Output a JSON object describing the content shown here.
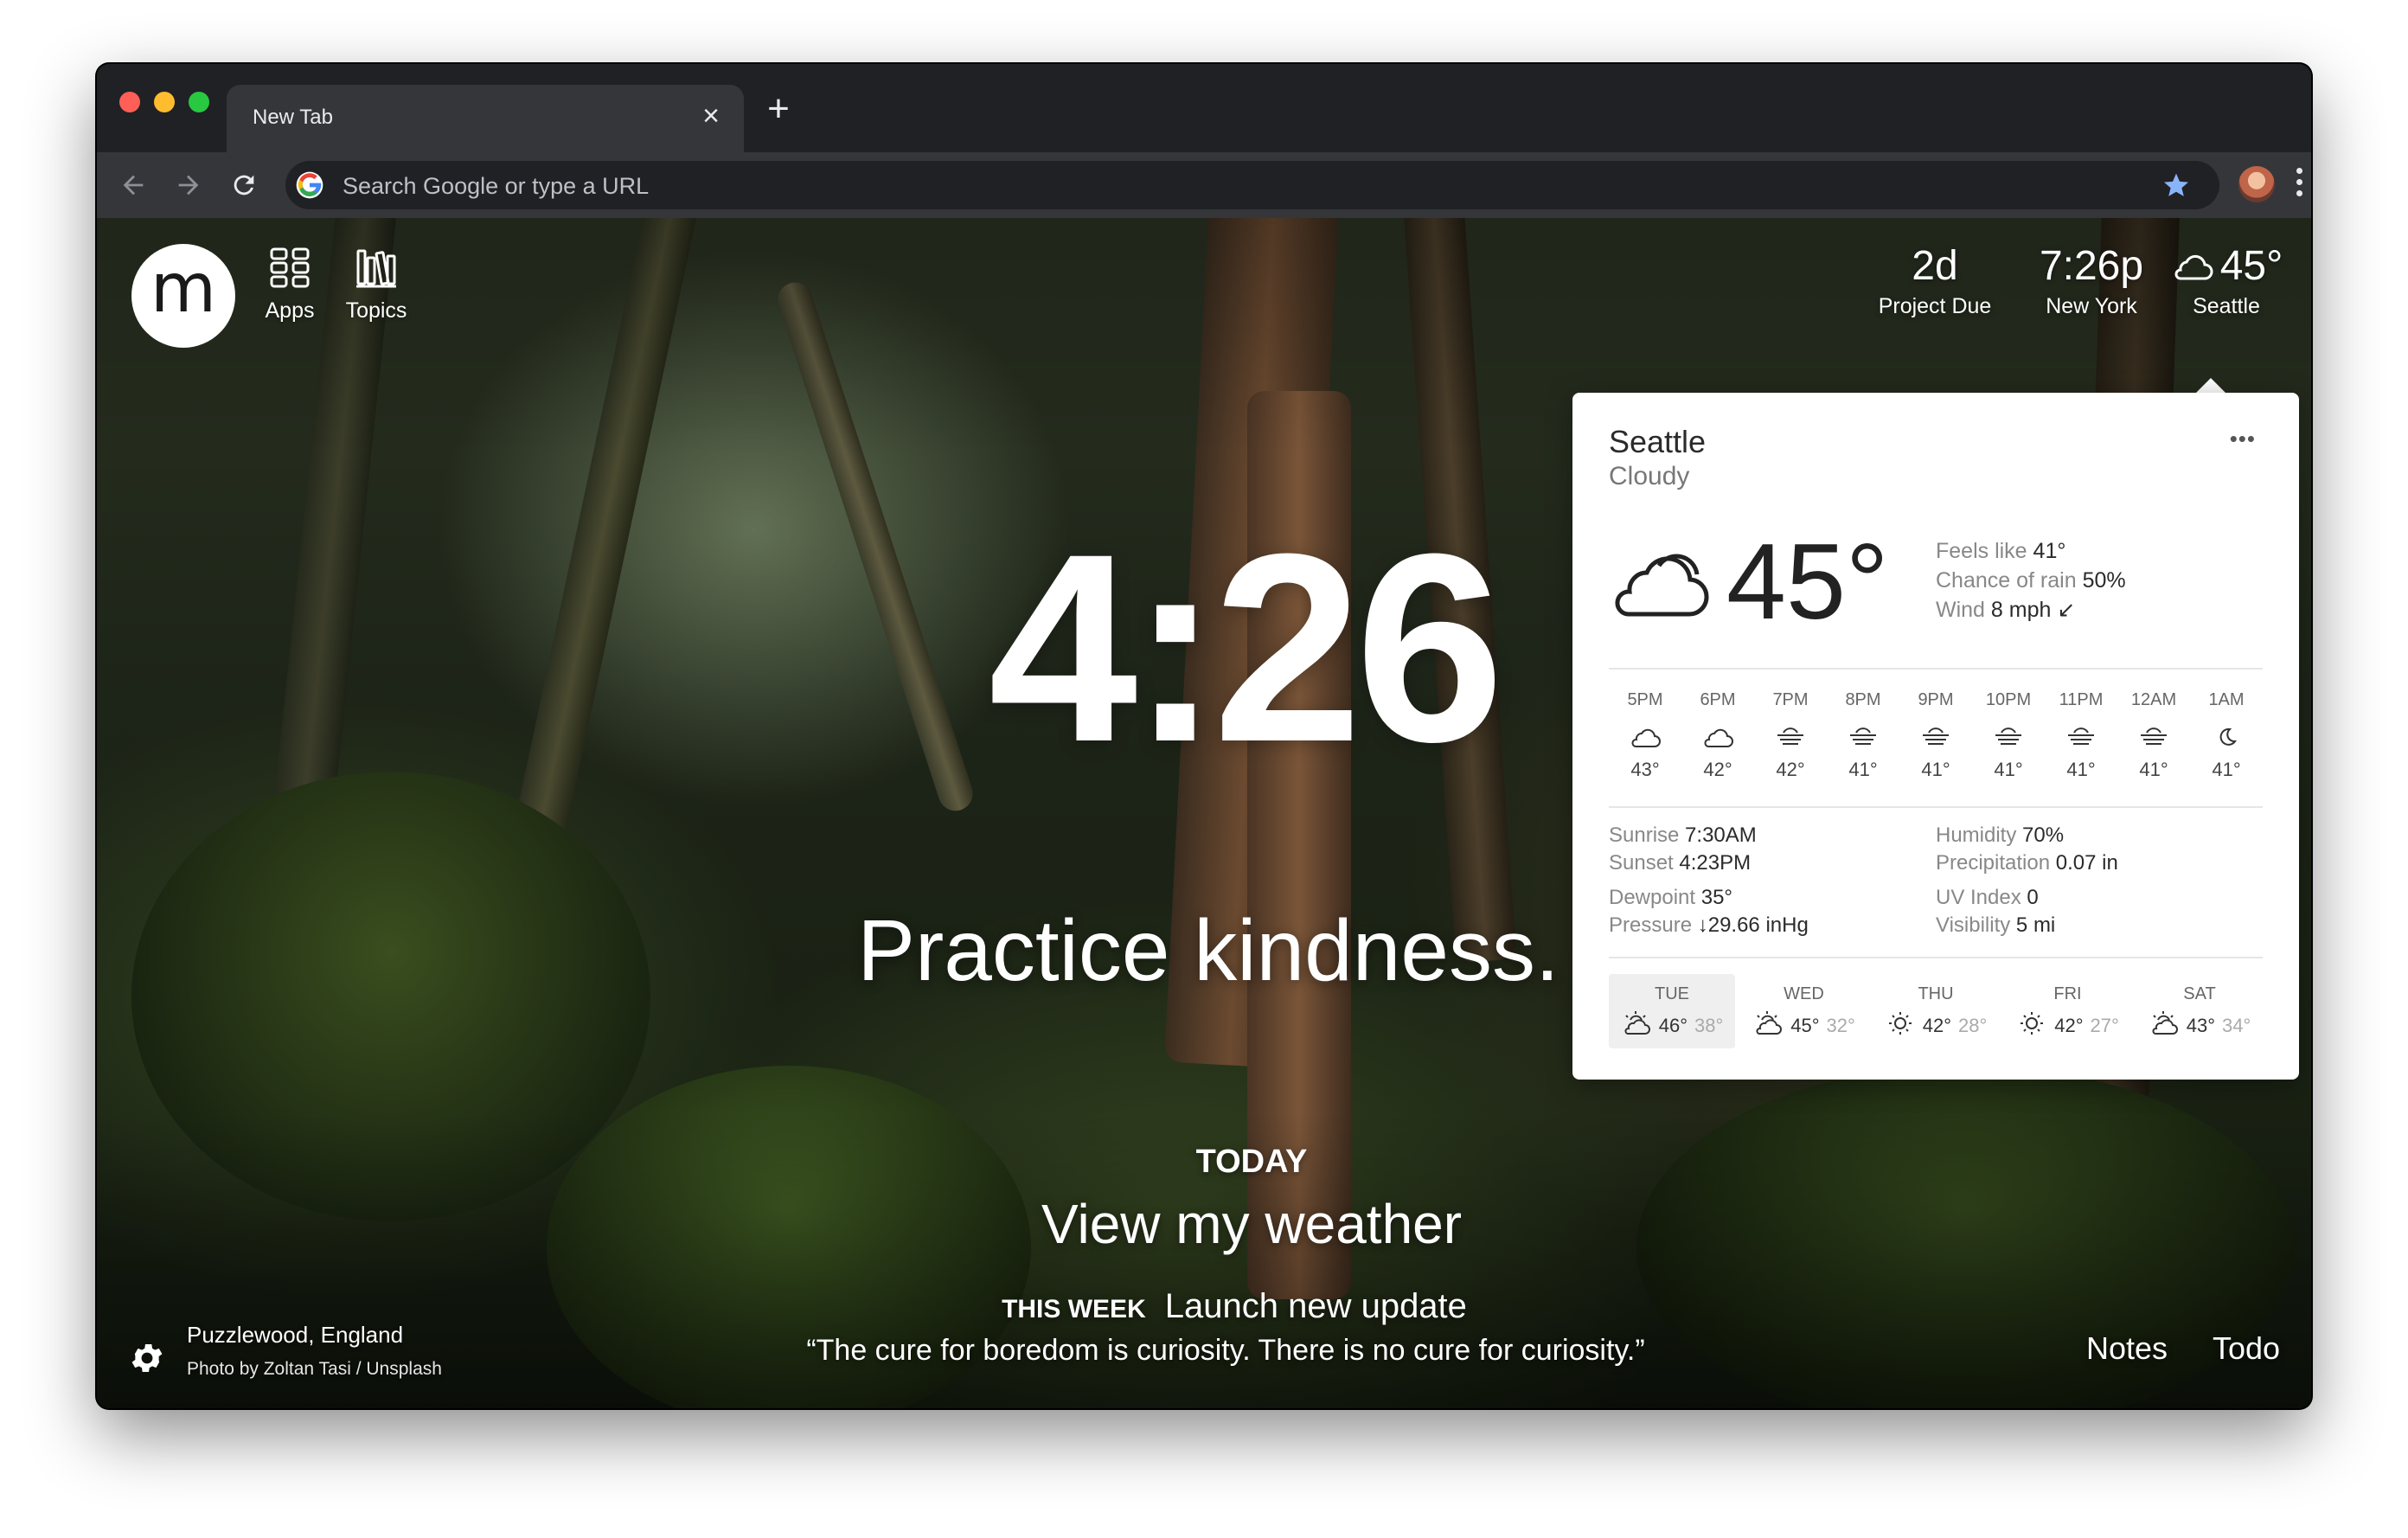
{
  "browser": {
    "tab_title": "New Tab",
    "tab_close": "×",
    "new_tab": "+",
    "omnibox_placeholder": "Search Google or type a URL"
  },
  "launcher": {
    "logo_letter": "m",
    "apps_label": "Apps",
    "topics_label": "Topics"
  },
  "widgets": {
    "countdown_value": "2d",
    "countdown_label": "Project Due",
    "time_value": "7:26p",
    "time_label": "New York",
    "weather_value": "45°",
    "weather_label": "Seattle"
  },
  "weather_panel": {
    "city": "Seattle",
    "condition": "Cloudy",
    "more": "•••",
    "temperature": "45°",
    "feels_like_label": "Feels like",
    "feels_like": "41°",
    "rain_label": "Chance of rain",
    "rain": "50%",
    "wind_label": "Wind",
    "wind": "8 mph ↙",
    "hourly": [
      {
        "time": "5PM",
        "icon": "cloud-icon",
        "temp": "43°"
      },
      {
        "time": "6PM",
        "icon": "cloud-icon",
        "temp": "42°"
      },
      {
        "time": "7PM",
        "icon": "fog-moon-icon",
        "temp": "42°"
      },
      {
        "time": "8PM",
        "icon": "fog-moon-icon",
        "temp": "41°"
      },
      {
        "time": "9PM",
        "icon": "fog-moon-icon",
        "temp": "41°"
      },
      {
        "time": "10PM",
        "icon": "fog-moon-icon",
        "temp": "41°"
      },
      {
        "time": "11PM",
        "icon": "fog-moon-icon",
        "temp": "41°"
      },
      {
        "time": "12AM",
        "icon": "fog-moon-icon",
        "temp": "41°"
      },
      {
        "time": "1AM",
        "icon": "moon-icon",
        "temp": "41°"
      }
    ],
    "details": {
      "sunrise_label": "Sunrise",
      "sunrise": "7:30AM",
      "sunset_label": "Sunset",
      "sunset": "4:23PM",
      "humidity_label": "Humidity",
      "humidity": "70%",
      "precip_label": "Precipitation",
      "precip": "0.07 in",
      "dewpoint_label": "Dewpoint",
      "dewpoint": "35°",
      "pressure_label": "Pressure",
      "pressure": "↓29.66 inHg",
      "uv_label": "UV Index",
      "uv": "0",
      "visibility_label": "Visibility",
      "visibility": "5 mi"
    },
    "daily": [
      {
        "day": "TUE",
        "icon": "partly-sunny-icon",
        "hi": "46°",
        "lo": "38°"
      },
      {
        "day": "WED",
        "icon": "partly-sunny-icon",
        "hi": "45°",
        "lo": "32°"
      },
      {
        "day": "THU",
        "icon": "sun-icon",
        "hi": "42°",
        "lo": "28°"
      },
      {
        "day": "FRI",
        "icon": "sun-icon",
        "hi": "42°",
        "lo": "27°"
      },
      {
        "day": "SAT",
        "icon": "partly-sunny-icon",
        "hi": "43°",
        "lo": "34°"
      }
    ]
  },
  "center": {
    "clock": "4:26",
    "mantra": "Practice kindness.",
    "today_label": "TODAY",
    "today_focus": "View my weather",
    "week_label": "THIS WEEK",
    "week_focus": "Launch new update"
  },
  "footer": {
    "location": "Puzzlewood, England",
    "credit": "Photo by Zoltan Tasi / Unsplash",
    "quote": "“The cure for boredom is curiosity. There is no cure for curiosity.”",
    "notes": "Notes",
    "todo": "Todo"
  },
  "colors": {
    "accent_star": "#8ab4f8",
    "panel_bg": "#ffffff",
    "chrome_dark": "#202124"
  }
}
